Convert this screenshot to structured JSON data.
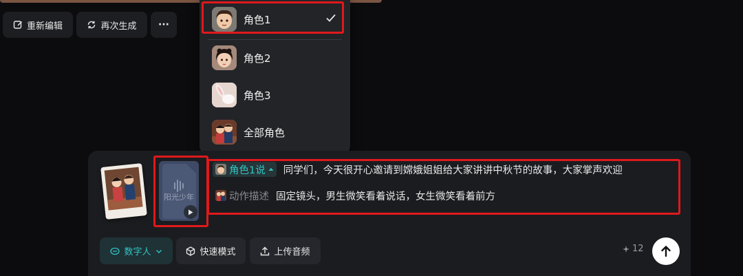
{
  "toolbar": {
    "edit_label": "重新编辑",
    "regenerate_label": "再次生成",
    "more_label": "···"
  },
  "role_menu": {
    "items": [
      {
        "label": "角色1",
        "selected": true,
        "thumb": "man-avatar"
      },
      {
        "label": "角色2",
        "selected": false,
        "thumb": "woman-avatar"
      },
      {
        "label": "角色3",
        "selected": false,
        "thumb": "rabbit-avatar"
      },
      {
        "label": "全部角色",
        "selected": false,
        "thumb": "group-avatar"
      }
    ]
  },
  "composer": {
    "audio_title": "阳光少年",
    "script_lines": [
      {
        "tag": "角色1说",
        "text": "同学们，今天很开心邀请到嫦娥姐姐给大家讲讲中秋节的故事，大家掌声欢迎"
      },
      {
        "tag": "动作描述",
        "text": "固定镜头，男生微笑看着说话，女生微笑看着前方"
      }
    ],
    "mode_buttons": {
      "digital_human": "数字人",
      "fast_mode": "快速模式",
      "upload_audio": "上传音频"
    },
    "credit_count": "12"
  },
  "colors": {
    "accent": "#2fc5c3",
    "highlight_box": "#e0191b",
    "background": "#0c0c0e"
  }
}
